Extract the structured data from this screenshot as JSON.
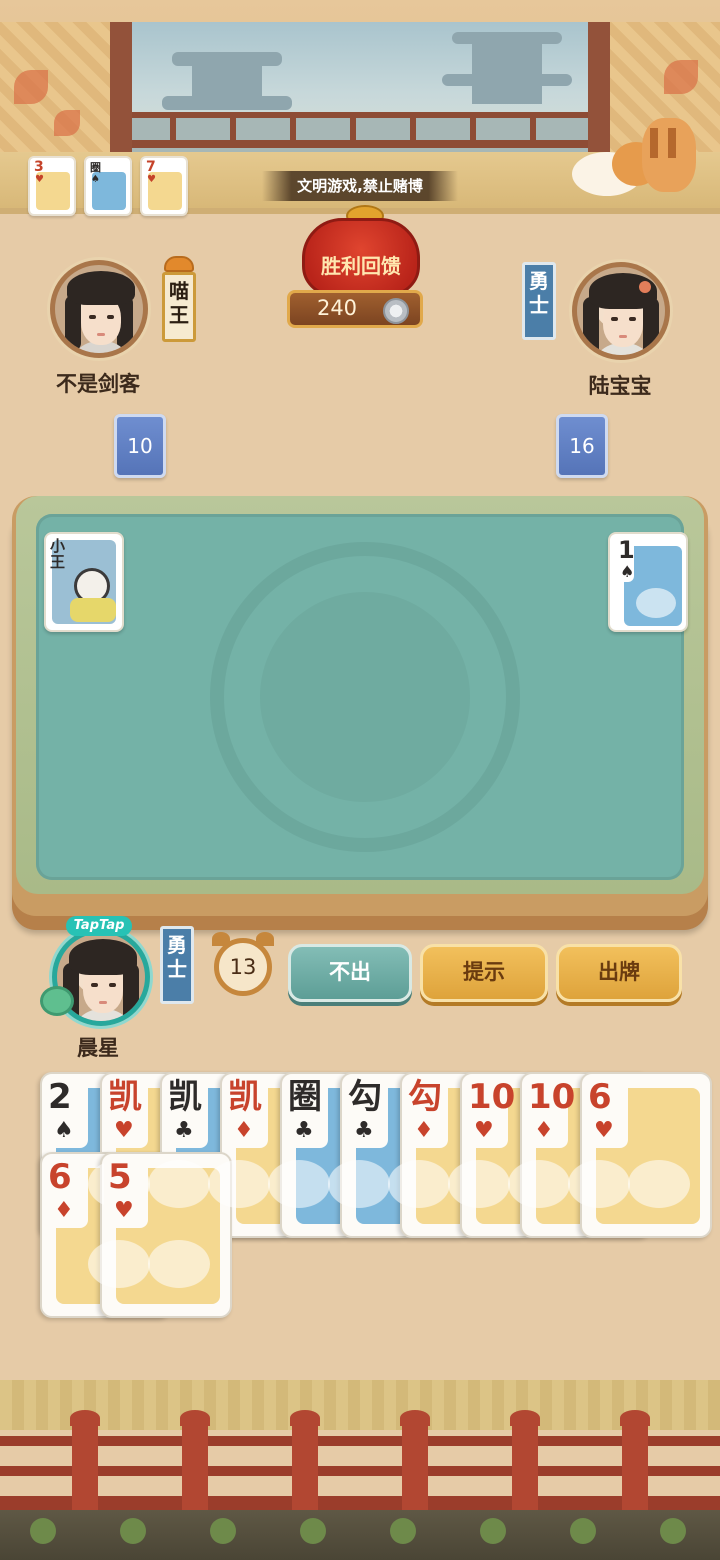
{
  "notice": "文明游戏,禁止赌博",
  "mini_cards": [
    {
      "rank": "3",
      "suit": "♥",
      "color": "yellow"
    },
    {
      "rank": "圈",
      "suit": "♠",
      "color": "blue"
    },
    {
      "rank": "7",
      "suit": "♥",
      "color": "yellow"
    }
  ],
  "prize": {
    "label": "胜利回馈",
    "value": "240"
  },
  "players": {
    "left": {
      "name": "不是剑客",
      "title": "喵王",
      "card_count": "10"
    },
    "right": {
      "name": "陆宝宝",
      "title": "勇士",
      "card_count": "16"
    },
    "self": {
      "name": "晨星",
      "title": "勇士",
      "badge": "TapTap"
    }
  },
  "table": {
    "left_played": {
      "label": "小王",
      "type": "joker"
    },
    "right_played": {
      "rank": "1",
      "suit": "♠"
    }
  },
  "timer": "13",
  "actions": {
    "pass": "不出",
    "hint": "提示",
    "play": "出牌"
  },
  "hand": {
    "row1": [
      {
        "rank": "2",
        "suit": "♠",
        "color": "black",
        "panel": "blue"
      },
      {
        "rank": "凯",
        "suit": "♥",
        "color": "red",
        "panel": "yellow"
      },
      {
        "rank": "凯",
        "suit": "♣",
        "color": "black",
        "panel": "blue"
      },
      {
        "rank": "凯",
        "suit": "♦",
        "color": "red",
        "panel": "yellow"
      },
      {
        "rank": "圈",
        "suit": "♣",
        "color": "black",
        "panel": "blue"
      },
      {
        "rank": "勾",
        "suit": "♣",
        "color": "black",
        "panel": "blue"
      },
      {
        "rank": "勾",
        "suit": "♦",
        "color": "red",
        "panel": "yellow"
      },
      {
        "rank": "10",
        "suit": "♥",
        "color": "red",
        "panel": "yellow"
      },
      {
        "rank": "10",
        "suit": "♦",
        "color": "red",
        "panel": "yellow"
      },
      {
        "rank": "6",
        "suit": "♥",
        "color": "red",
        "panel": "yellow"
      }
    ],
    "row2": [
      {
        "rank": "6",
        "suit": "♦",
        "color": "red",
        "panel": "yellow"
      },
      {
        "rank": "5",
        "suit": "♥",
        "color": "red",
        "panel": "yellow"
      }
    ]
  }
}
